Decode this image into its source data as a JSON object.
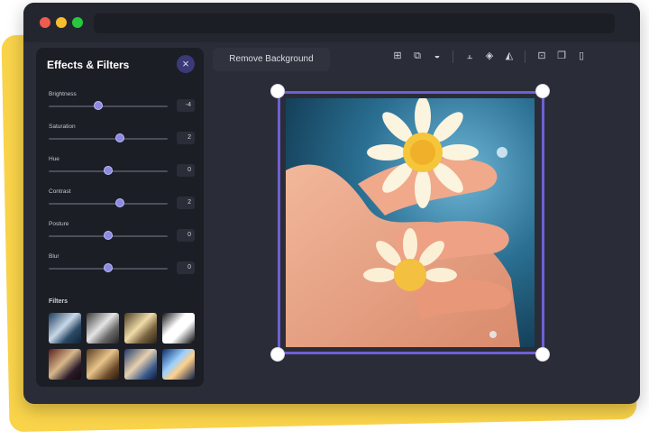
{
  "panel": {
    "title": "Effects & Filters",
    "close_icon": "×",
    "sliders": [
      {
        "label": "Brightness",
        "value": "-4",
        "position": 0.42
      },
      {
        "label": "Saturation",
        "value": "2",
        "position": 0.6
      },
      {
        "label": "Hue",
        "value": "0",
        "position": 0.5
      },
      {
        "label": "Contrast",
        "value": "2",
        "position": 0.6
      },
      {
        "label": "Posture",
        "value": "0",
        "position": 0.5
      },
      {
        "label": "Blur",
        "value": "0",
        "position": 0.5
      }
    ],
    "filters_label": "Filters",
    "filters": [
      "filter-1",
      "filter-2",
      "filter-3",
      "filter-4",
      "filter-5",
      "filter-6",
      "filter-7",
      "filter-8"
    ]
  },
  "toolbar": {
    "remove_background": "Remove Background",
    "icons": [
      "grid-icon",
      "layers-icon",
      "fill-icon",
      "align-icon",
      "stack-icon",
      "flip-icon",
      "lock-icon",
      "copy-icon",
      "trash-icon"
    ]
  },
  "colors": {
    "window": "#2a2d37",
    "panel": "#1c1e25",
    "accent": "#6f5fd6",
    "backdrop": "#f9d34a"
  }
}
